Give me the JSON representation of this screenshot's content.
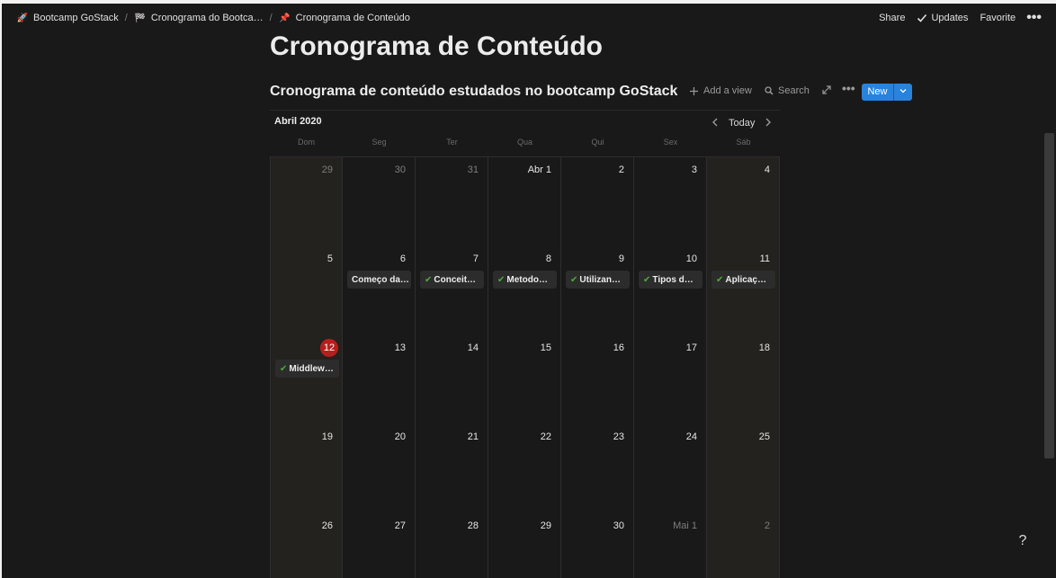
{
  "breadcrumb": [
    {
      "icon": "rocket-icon",
      "glyph": "🚀",
      "label": "Bootcamp GoStack"
    },
    {
      "icon": "checkered-flag-icon",
      "glyph": "🏁",
      "label": "Cronograma do Bootca…"
    },
    {
      "icon": "pushpin-icon",
      "glyph": "📌",
      "label": "Cronograma de Conteúdo"
    }
  ],
  "breadcrumb_separator": "/",
  "topbar": {
    "share": "Share",
    "updates": "Updates",
    "favorite": "Favorite",
    "more": "•••"
  },
  "page_title": "Cronograma de Conteúdo",
  "database": {
    "title": "Cronograma de conteúdo estudados no bootcamp GoStack",
    "add_view": "Add a view",
    "search": "Search",
    "more": "•••",
    "new": "New"
  },
  "calendar": {
    "month": "Abril 2020",
    "today": "Today",
    "weekdays": [
      "Dom",
      "Seg",
      "Ter",
      "Qua",
      "Qui",
      "Sex",
      "Sáb"
    ],
    "weeks": [
      [
        {
          "day": "29",
          "muted": true
        },
        {
          "day": "30",
          "muted": true
        },
        {
          "day": "31",
          "muted": true
        },
        {
          "day": "Abr 1"
        },
        {
          "day": "2"
        },
        {
          "day": "3"
        },
        {
          "day": "4"
        }
      ],
      [
        {
          "day": "5"
        },
        {
          "day": "6",
          "event": "Começo da…",
          "checked": false
        },
        {
          "day": "7",
          "event": "Conceit…",
          "checked": true
        },
        {
          "day": "8",
          "event": "Metodo…",
          "checked": true
        },
        {
          "day": "9",
          "event": "Utilizan…",
          "checked": true
        },
        {
          "day": "10",
          "event": "Tipos d…",
          "checked": true
        },
        {
          "day": "11",
          "event": "Aplicaç…",
          "checked": true
        }
      ],
      [
        {
          "day": "12",
          "today": true,
          "event": "Middlew…",
          "checked": true
        },
        {
          "day": "13"
        },
        {
          "day": "14"
        },
        {
          "day": "15"
        },
        {
          "day": "16"
        },
        {
          "day": "17"
        },
        {
          "day": "18"
        }
      ],
      [
        {
          "day": "19"
        },
        {
          "day": "20"
        },
        {
          "day": "21"
        },
        {
          "day": "22"
        },
        {
          "day": "23"
        },
        {
          "day": "24"
        },
        {
          "day": "25"
        }
      ],
      [
        {
          "day": "26"
        },
        {
          "day": "27"
        },
        {
          "day": "28"
        },
        {
          "day": "29"
        },
        {
          "day": "30"
        },
        {
          "day": "Mai 1",
          "muted": true
        },
        {
          "day": "2",
          "muted": true
        }
      ]
    ]
  },
  "help": "?",
  "colors": {
    "background": "#191919",
    "weekend": "#24221e",
    "today": "#b81e1e",
    "new_button": "#2783de",
    "check": "#4faa3a"
  }
}
